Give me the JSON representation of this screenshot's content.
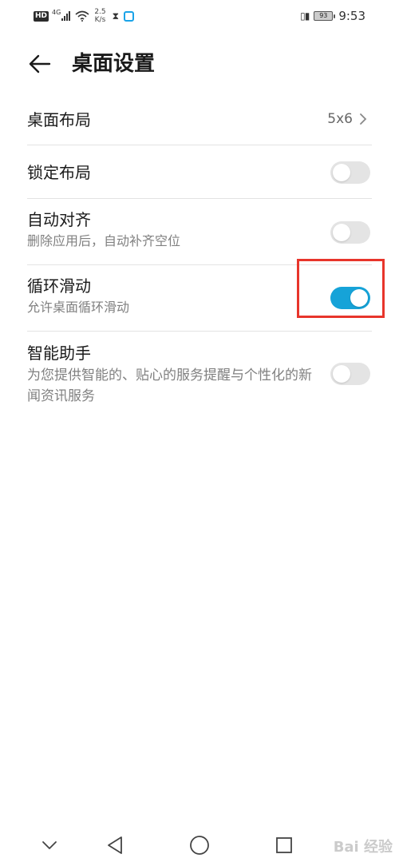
{
  "status_bar": {
    "hd_badge": "HD",
    "network": "4G",
    "speed_value": "2.5",
    "speed_unit": "K/s",
    "battery": "93",
    "time": "9:53"
  },
  "header": {
    "title": "桌面设置"
  },
  "settings": [
    {
      "title": "桌面布局",
      "value": "5x6"
    },
    {
      "title": "锁定布局",
      "enabled": false
    },
    {
      "title": "自动对齐",
      "subtitle": "删除应用后，自动补齐空位",
      "enabled": false
    },
    {
      "title": "循环滑动",
      "subtitle": "允许桌面循环滑动",
      "enabled": true
    },
    {
      "title": "智能助手",
      "subtitle": "为您提供智能的、贴心的服务提醒与个性化的新闻资讯服务",
      "enabled": false
    }
  ],
  "colors": {
    "toggle_on": "#16a3d8",
    "toggle_off": "#e4e4e4",
    "highlight": "#e8352b"
  },
  "watermark": "Bai 经验"
}
